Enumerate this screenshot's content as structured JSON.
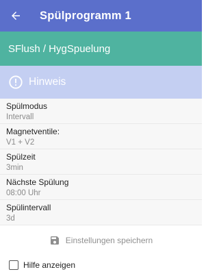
{
  "header": {
    "title": "Spülprogramm 1",
    "bg_color": "#5b6fcb",
    "back_icon": "arrow-left-icon"
  },
  "subheader": {
    "text": "SFlush / HygSpuelung",
    "bg_color": "#4fb3a0"
  },
  "notice": {
    "text": "Hinweis",
    "icon": "alert-circle-icon",
    "bg_color": "#c4cff2"
  },
  "settings": [
    {
      "label": "Spülmodus",
      "value": "Intervall"
    },
    {
      "label": "Magnetventile:",
      "value": "V1 + V2"
    },
    {
      "label": "Spülzeit",
      "value": "3min"
    },
    {
      "label": "Nächste Spülung",
      "value": "08:00 Uhr"
    },
    {
      "label": "Spülintervall",
      "value": "3d"
    }
  ],
  "save_button": {
    "label": "Einstellungen speichern",
    "icon": "save-icon"
  },
  "help": {
    "label": "Hilfe anzeigen",
    "checked": false
  }
}
